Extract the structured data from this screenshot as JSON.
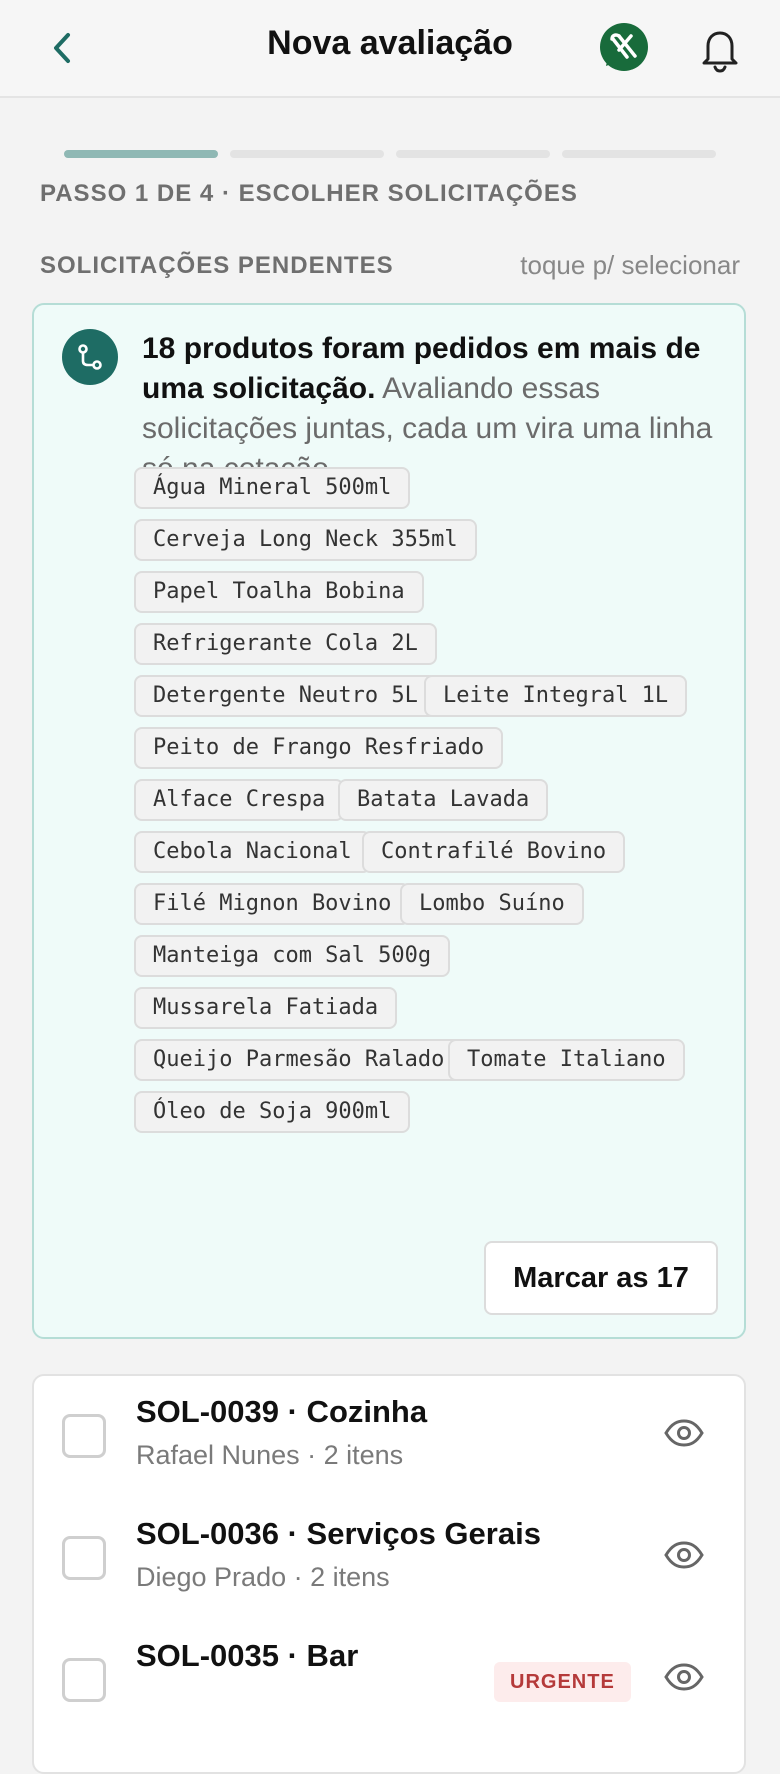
{
  "header": {
    "title": "Nova avaliação",
    "back_icon": "chevron-left-icon",
    "logo_icon": "brand-chat-logo",
    "notifications_icon": "bell-icon"
  },
  "progress": {
    "current_step": 1,
    "total_steps": 4
  },
  "step_label": "PASSO 1 DE 4 · ESCOLHER SOLICITAÇÕES",
  "section": {
    "title": "SOLICITAÇÕES PENDENTES",
    "hint": "toque p/ selecionar"
  },
  "info_card": {
    "icon": "merge-icon",
    "bold_text": "18 produtos foram pedidos em mais de uma solicitação.",
    "text": " Avaliando essas solicitações juntas, cada um vira uma linha só na cotação.",
    "products": [
      "Água Mineral 500ml",
      "Cerveja Long Neck 355ml",
      "Papel Toalha Bobina",
      "Refrigerante Cola 2L",
      "Detergente Neutro 5L",
      "Leite Integral 1L",
      "Peito de Frango Resfriado",
      "Alface Crespa",
      "Batata Lavada",
      "Cebola Nacional",
      "Contrafilé Bovino",
      "Filé Mignon Bovino",
      "Lombo Suíno",
      "Manteiga com Sal 500g",
      "Mussarela Fatiada",
      "Queijo Parmesão Ralado",
      "Tomate Italiano",
      "Óleo de Soja 900ml"
    ],
    "mark_button": "Marcar as 17"
  },
  "requests": [
    {
      "title": "SOL-0039 · Cozinha",
      "subtitle": "Rafael Nunes · 2 itens",
      "badge": ""
    },
    {
      "title": "SOL-0036 · Serviços Gerais",
      "subtitle": "Diego Prado · 2 itens",
      "badge": ""
    },
    {
      "title": "SOL-0035 · Bar",
      "subtitle": "",
      "badge": "URGENTE"
    }
  ],
  "colors": {
    "accent": "#1e6c64",
    "progress_active": "#8fb8b4",
    "card_bg": "#effbf9",
    "card_border": "#b5ddd6",
    "urgent": "#b53a3a"
  }
}
